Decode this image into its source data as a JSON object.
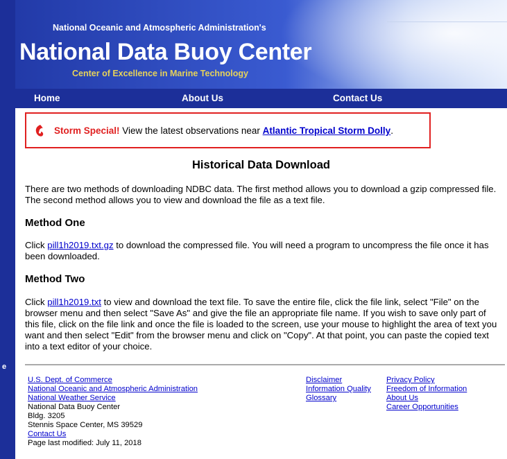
{
  "header": {
    "org": "National Oceanic and Atmospheric Administration's",
    "site_title": "National Data Buoy Center",
    "tagline": "Center of Excellence in Marine Technology"
  },
  "nav": {
    "home": "Home",
    "about": "About Us",
    "contact": "Contact Us"
  },
  "alert": {
    "label": "Storm Special!",
    "text": " View the latest observations near ",
    "link": "Atlantic Tropical Storm Dolly",
    "end": "."
  },
  "page_title": "Historical Data Download",
  "intro": "There are two methods of downloading NDBC data. The first method allows you to download a gzip compressed file. The second method allows you to view and download the file as a text file.",
  "method_one": {
    "heading": "Method One",
    "pre": "Click ",
    "link": "pill1h2019.txt.gz",
    "post": " to download the compressed file. You will need a program to uncompress the file once it has been downloaded."
  },
  "method_two": {
    "heading": "Method Two",
    "pre": "Click ",
    "link": "pill1h2019.txt",
    "post": " to view and download the text file. To save the entire file, click the file link, select \"File\" on the browser menu and then select \"Save As\" and give the file an appropriate file name. If you wish to save only part of this file, click on the file link and once the file is loaded to the screen, use your mouse to highlight the area of text you want and then select \"Edit\" from the browser menu and click on \"Copy\". At that point, you can paste the copied text into a text editor of your choice."
  },
  "footer": {
    "doc": "U.S. Dept. of Commerce",
    "noaa": "National Oceanic and Atmospheric Administration",
    "nws": "National Weather Service",
    "ndbc": "National Data Buoy Center",
    "bldg": "Bldg. 3205",
    "city": "Stennis Space Center, MS 39529",
    "contact": "Contact Us",
    "modified": "Page last modified: July 11, 2018",
    "disclaimer": "Disclaimer",
    "info_quality": "Information Quality",
    "glossary": "Glossary",
    "privacy": "Privacy Policy",
    "foia": "Freedom of Information",
    "about": "About Us",
    "careers": "Career Opportunities"
  },
  "left_bar_char": "e",
  "colors": {
    "nav_bg": "#1c2f99",
    "alert_red": "#e02020",
    "link": "#0000cc",
    "tagline": "#e6d25a"
  }
}
